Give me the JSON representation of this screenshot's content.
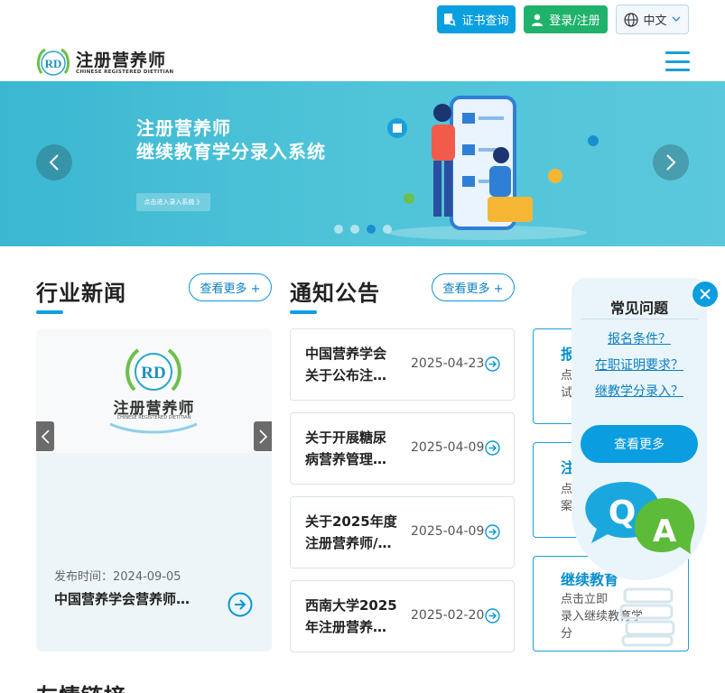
{
  "topbar": {
    "cert_label": "证书查询",
    "login_label": "登录/注册",
    "lang_label": "中文"
  },
  "header": {
    "logo_cn": "注册营养师",
    "logo_en": "CHINESE REGISTERED DIETITIAN",
    "logo_mark": "RD"
  },
  "banner": {
    "line1": "注册营养师",
    "line2": "继续教育学分录入系统",
    "enter_label": "点击进入录入系统 》",
    "slide_count": 4,
    "active_slide": 3
  },
  "news": {
    "title": "行业新闻",
    "more_label": "查看更多 +",
    "card": {
      "logo_mark": "RD",
      "logo_cn": "注册营养师",
      "logo_en": "CHINESE REGISTERED DIETITIAN",
      "date": "发布时间：2024-09-05",
      "headline": "中国营养学会营养师…"
    }
  },
  "notices": {
    "title": "通知公告",
    "more_label": "查看更多 +",
    "items": [
      {
        "line1": "中国营养学会",
        "line2": "关于公布注…",
        "date": "2025-04-23"
      },
      {
        "line1": "关于开展糖尿",
        "line2": "病营养管理…",
        "date": "2025-04-09"
      },
      {
        "line1": "关于2025年度",
        "line2": "注册营养师/…",
        "date": "2025-04-09"
      },
      {
        "line1": "西南大学2025",
        "line2": "年注册营养…",
        "date": "2025-02-20"
      }
    ]
  },
  "quick": [
    {
      "heading": "报",
      "desc": "点\n试"
    },
    {
      "heading": "注",
      "desc": "点\n案"
    },
    {
      "heading": "继续教育",
      "desc": "点击立即\n录入继续教育学\n分"
    }
  ],
  "faq": {
    "title": "常见问题",
    "questions": [
      "报名条件？",
      "在职证明要求？",
      "继教学分录入？"
    ],
    "more_label": "查看更多"
  },
  "footer": {
    "friend_links": "友情链接"
  },
  "colors": {
    "accent": "#0aa0e0",
    "green": "#20b26b"
  }
}
